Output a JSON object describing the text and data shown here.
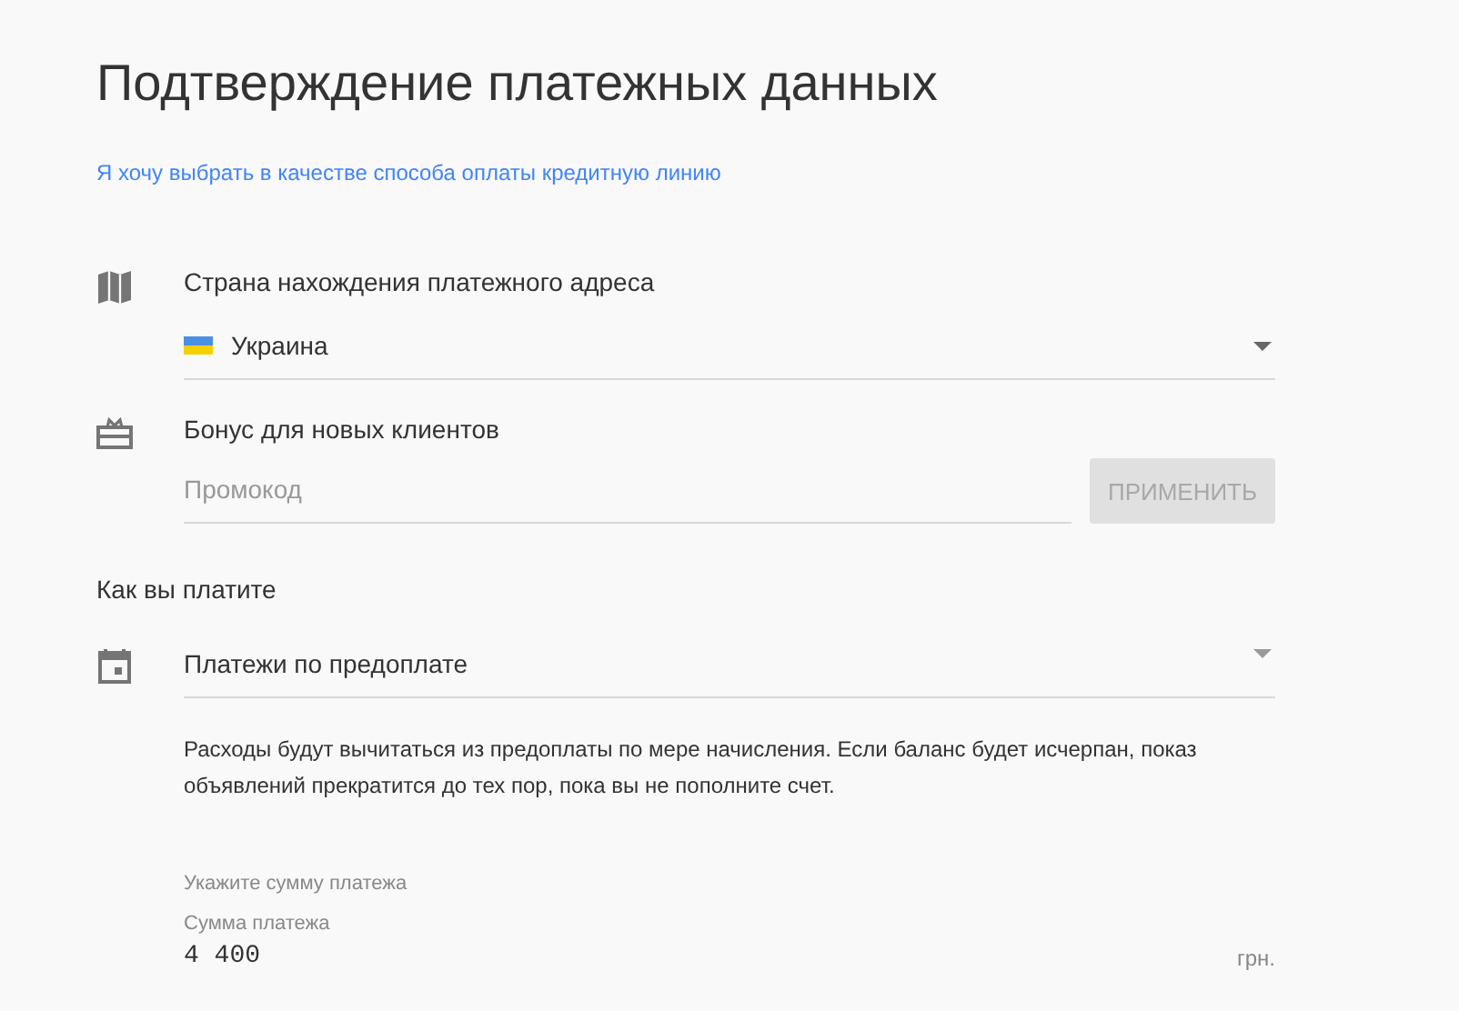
{
  "title": "Подтверждение платежных данных",
  "credit_line_link": "Я хочу выбрать в качестве способа оплаты кредитную линию",
  "country": {
    "label": "Страна нахождения платежного адреса",
    "value": "Украина"
  },
  "bonus": {
    "label": "Бонус для новых клиентов",
    "placeholder": "Промокод",
    "apply_button": {
      "label": "ПРИМЕНИТЬ",
      "disabled": true
    }
  },
  "payment_section": {
    "heading": "Как вы платите",
    "method": "Платежи по предоплате",
    "description": "Расходы будут вычитаться из предоплаты по мере начисления. Если баланс будет исчерпан, показ объявлений прекратится до тех пор, пока вы не пополните счет.",
    "amount_hint": "Укажите сумму платежа",
    "amount_label": "Сумма платежа",
    "amount_value": "4 400",
    "currency": "грн."
  }
}
